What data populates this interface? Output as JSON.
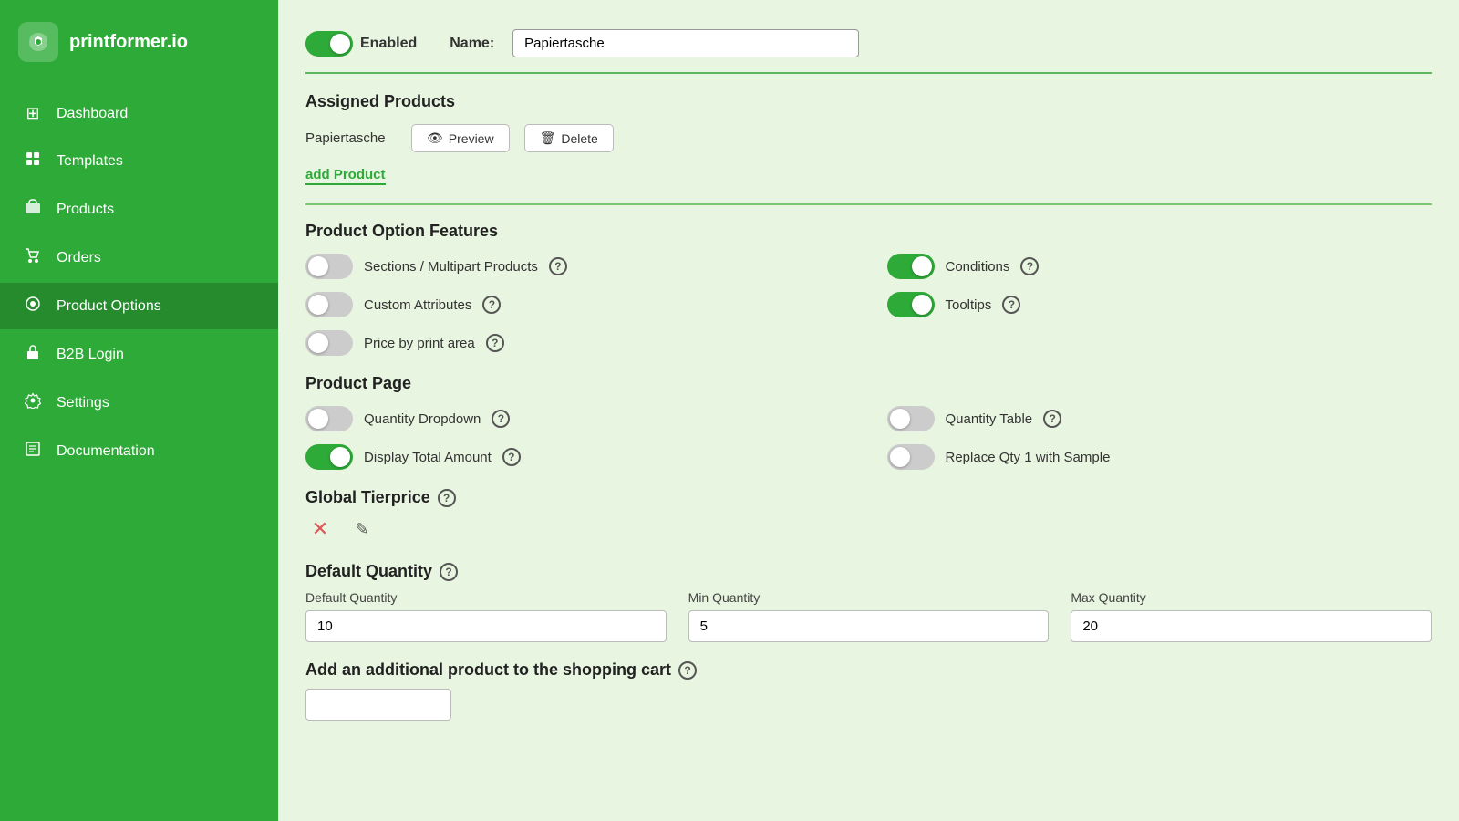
{
  "sidebar": {
    "logo_text": "printformer.io",
    "items": [
      {
        "id": "dashboard",
        "label": "Dashboard",
        "icon": "⊞",
        "active": false
      },
      {
        "id": "templates",
        "label": "Templates",
        "icon": "✦",
        "active": false
      },
      {
        "id": "products",
        "label": "Products",
        "icon": "🛍",
        "active": false
      },
      {
        "id": "orders",
        "label": "Orders",
        "icon": "🛒",
        "active": false
      },
      {
        "id": "product-options",
        "label": "Product Options",
        "icon": "⊙",
        "active": true
      },
      {
        "id": "b2b-login",
        "label": "B2B Login",
        "icon": "🔒",
        "active": false
      },
      {
        "id": "settings",
        "label": "Settings",
        "icon": "⚙",
        "active": false
      },
      {
        "id": "documentation",
        "label": "Documentation",
        "icon": "☰",
        "active": false
      }
    ]
  },
  "top_bar": {
    "enabled_label": "Enabled",
    "name_label": "Name:",
    "name_value": "Papiertasche",
    "toggle_state": "on"
  },
  "assigned_products": {
    "title": "Assigned Products",
    "product_name": "Papiertasche",
    "preview_btn": "Preview",
    "delete_btn": "Delete",
    "add_link": "add Product"
  },
  "product_option_features": {
    "title": "Product Option Features",
    "features_left": [
      {
        "id": "sections",
        "label": "Sections / Multipart Products",
        "state": "off",
        "help": "?"
      },
      {
        "id": "custom-attrs",
        "label": "Custom Attributes",
        "state": "off",
        "help": "?"
      },
      {
        "id": "price-by-print",
        "label": "Price by print area",
        "state": "off",
        "help": "?"
      }
    ],
    "features_right": [
      {
        "id": "conditions",
        "label": "Conditions",
        "state": "on",
        "help": "?"
      },
      {
        "id": "tooltips",
        "label": "Tooltips",
        "state": "on",
        "help": "?"
      }
    ]
  },
  "product_page": {
    "title": "Product Page",
    "features_left": [
      {
        "id": "qty-dropdown",
        "label": "Quantity Dropdown",
        "state": "off",
        "help": "?"
      },
      {
        "id": "display-total",
        "label": "Display Total Amount",
        "state": "on",
        "help": "?"
      }
    ],
    "features_right": [
      {
        "id": "qty-table",
        "label": "Quantity Table",
        "state": "off",
        "help": "?"
      },
      {
        "id": "replace-qty",
        "label": "Replace Qty 1 with Sample",
        "state": "off",
        "help": ""
      }
    ]
  },
  "global_tierprice": {
    "title": "Global Tierprice",
    "help": "?",
    "delete_icon": "✕",
    "edit_icon": "✎"
  },
  "default_quantity": {
    "title": "Default Quantity",
    "help": "?",
    "fields": [
      {
        "id": "default-qty",
        "label": "Default Quantity",
        "value": "10"
      },
      {
        "id": "min-qty",
        "label": "Min Quantity",
        "value": "5"
      },
      {
        "id": "max-qty",
        "label": "Max Quantity",
        "value": "20"
      }
    ]
  },
  "additional_product": {
    "title": "Add an additional product to the shopping cart",
    "help": "?",
    "value": ""
  }
}
